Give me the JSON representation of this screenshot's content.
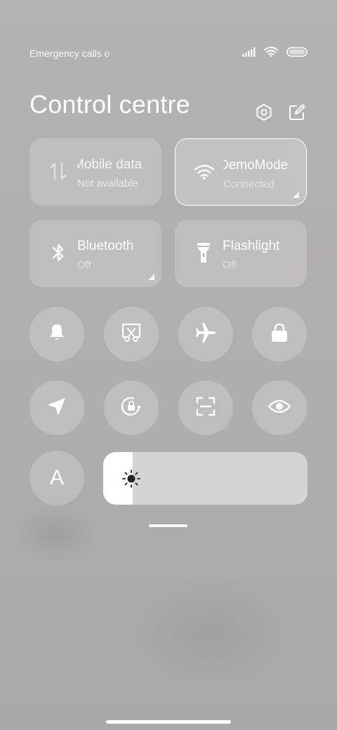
{
  "status_bar": {
    "carrier_text": "Emergency calls o",
    "icons": [
      "signal-icon",
      "wifi-icon",
      "battery-icon"
    ]
  },
  "header": {
    "title": "Control centre",
    "icons": [
      "settings-icon",
      "edit-icon"
    ]
  },
  "tiles": [
    {
      "name": "Mobile data",
      "status": "Not available",
      "icon": "mobile-data-icon",
      "active": false
    },
    {
      "name": "DemoMode",
      "status": "Connected",
      "icon": "wifi-icon",
      "active": true
    },
    {
      "name": "Bluetooth",
      "status": "Off",
      "icon": "bluetooth-icon",
      "active": false
    },
    {
      "name": "Flashlight",
      "status": "Off",
      "icon": "flashlight-icon",
      "active": false
    }
  ],
  "toggles": [
    "bell-icon",
    "screenshot-icon",
    "airplane-icon",
    "lock-icon",
    "location-icon",
    "rotation-lock-icon",
    "scanner-icon",
    "eye-icon",
    "auto-brightness-icon"
  ],
  "auto_brightness_label": "A",
  "brightness": {
    "icon": "sun-icon",
    "level": 0.145
  },
  "colors": {
    "background": "#b0b0b0",
    "tile_bg": "rgba(255,255,255,0.18)",
    "active_border": "#ffffff",
    "slider_fill": "#ffffff",
    "slider_track": "#dcdcdc"
  }
}
